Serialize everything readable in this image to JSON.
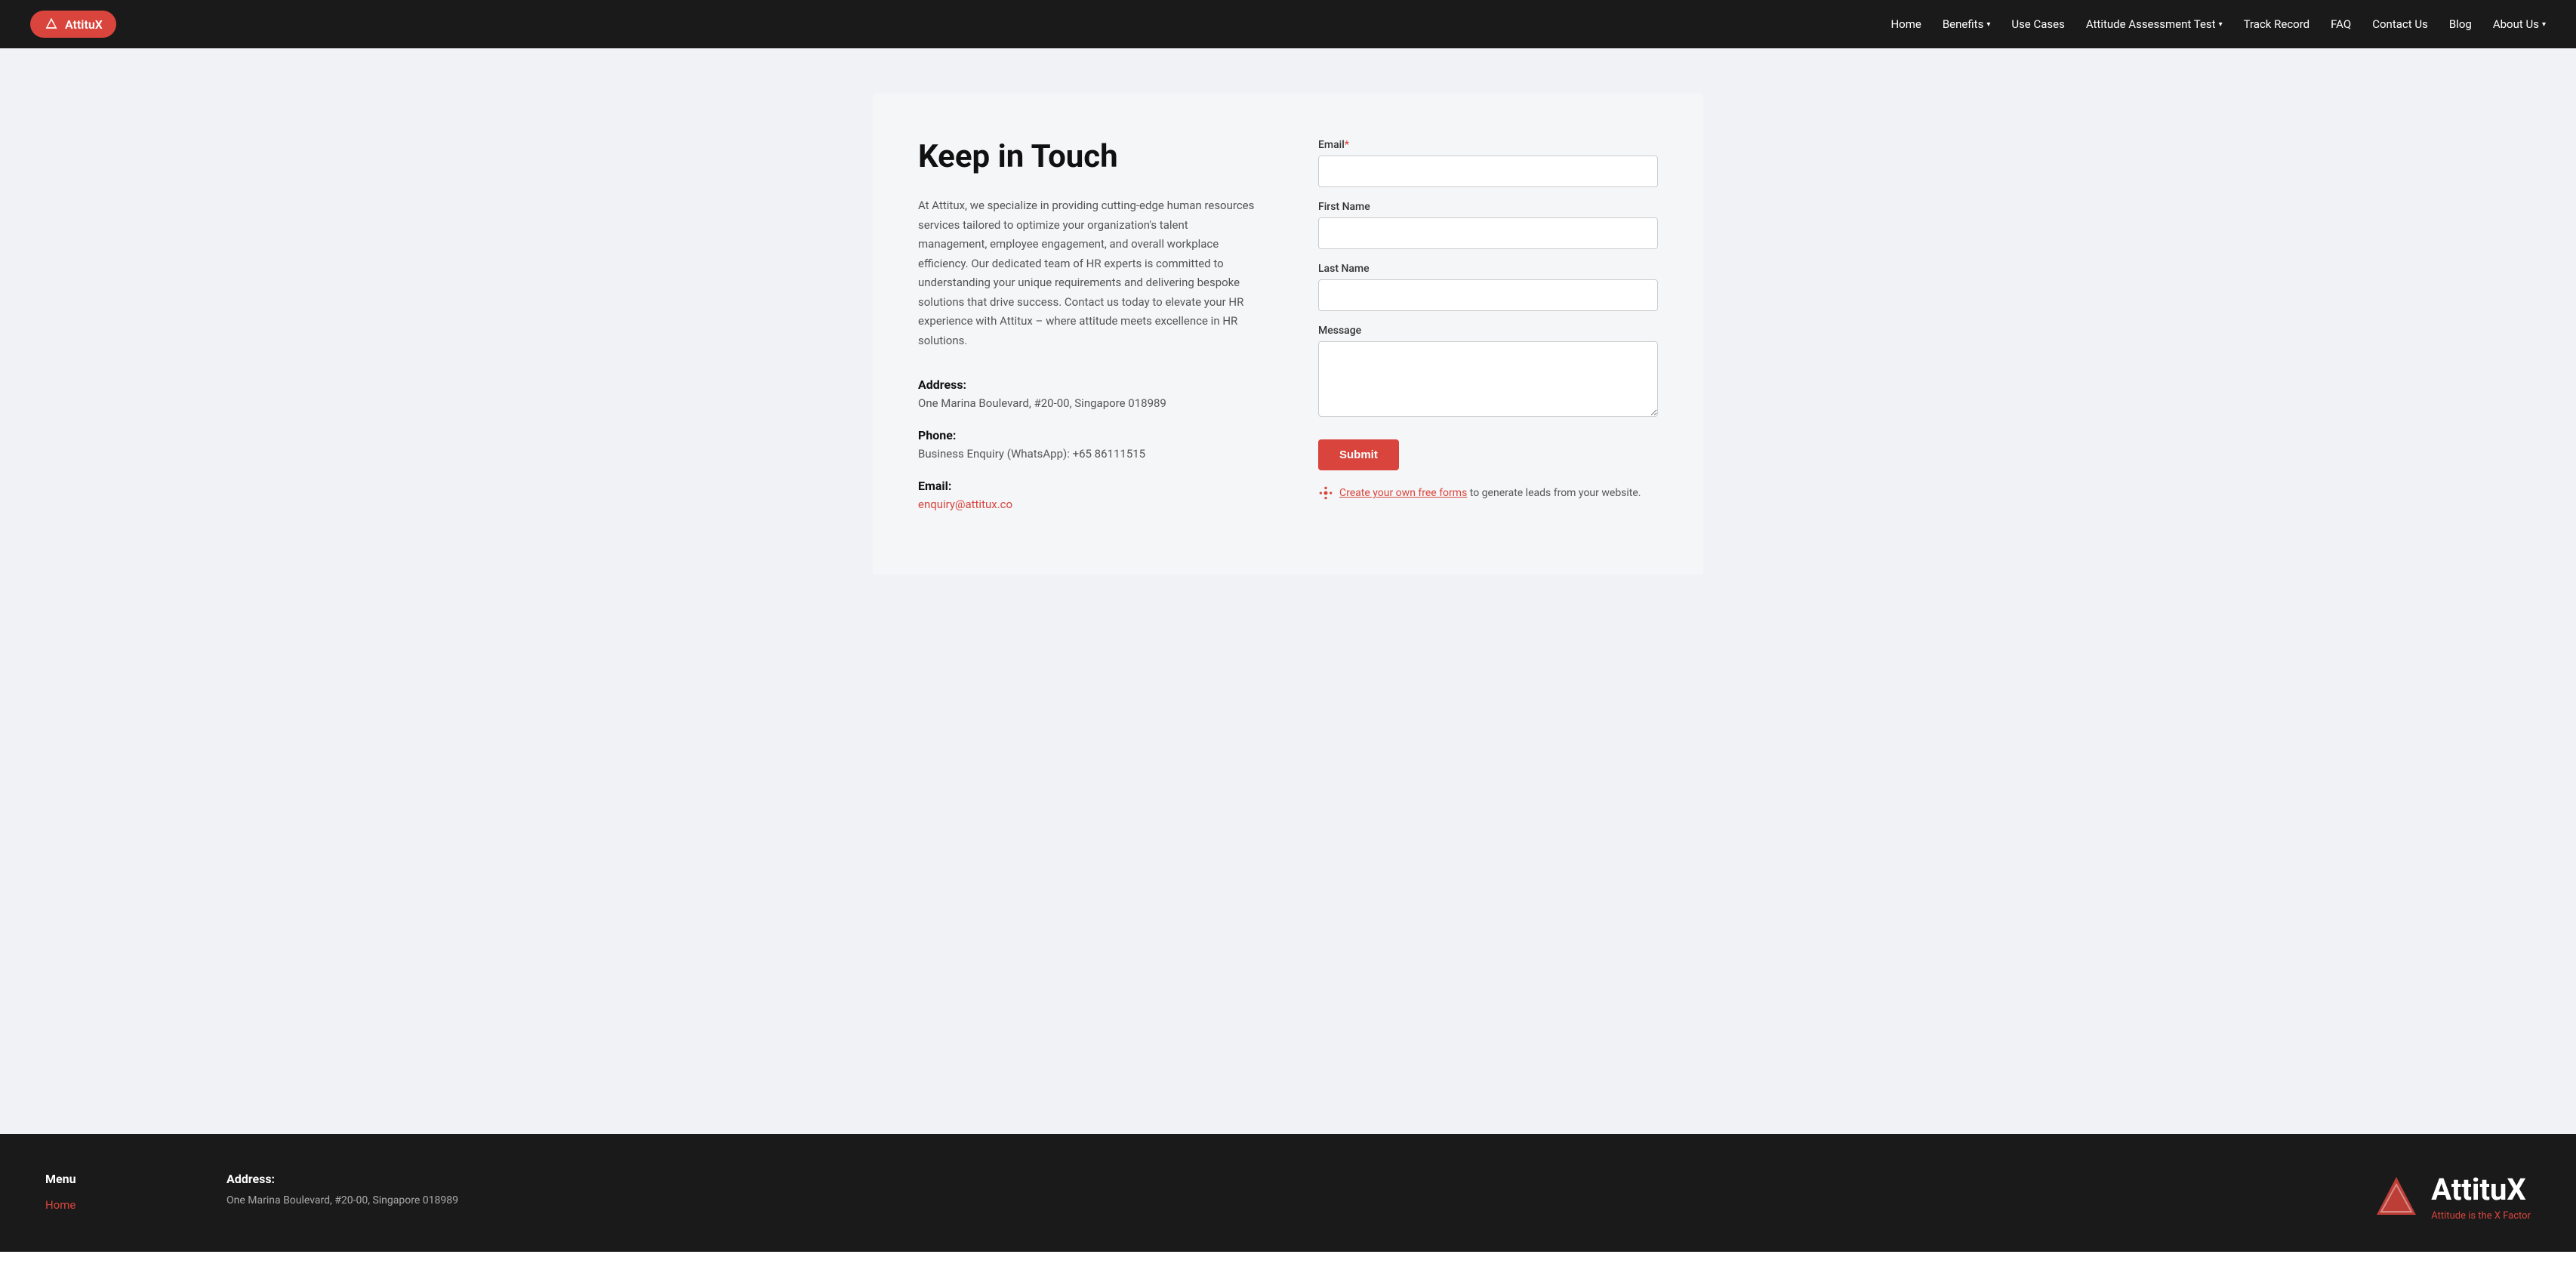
{
  "navbar": {
    "logo_text": "AttituX",
    "nav_items": [
      {
        "label": "Home",
        "has_dropdown": false
      },
      {
        "label": "Benefits",
        "has_dropdown": true
      },
      {
        "label": "Use Cases",
        "has_dropdown": false
      },
      {
        "label": "Attitude Assessment Test",
        "has_dropdown": true
      },
      {
        "label": "Track Record",
        "has_dropdown": false
      },
      {
        "label": "FAQ",
        "has_dropdown": false
      },
      {
        "label": "Contact Us",
        "has_dropdown": false
      },
      {
        "label": "Blog",
        "has_dropdown": false
      },
      {
        "label": "About Us",
        "has_dropdown": true
      }
    ]
  },
  "contact": {
    "title": "Keep in Touch",
    "description": "At Attitux, we specialize in providing cutting-edge human resources services tailored to optimize your organization's talent management, employee engagement, and overall workplace efficiency. Our dedicated team of HR experts is committed to understanding your unique requirements and delivering bespoke solutions that drive success. Contact us today to elevate your HR experience with Attitux – where attitude meets excellence in HR solutions.",
    "address_label": "Address:",
    "address_value": "One Marina Boulevard, #20-00, Singapore 018989",
    "phone_label": "Phone:",
    "phone_value": "Business Enquiry (WhatsApp): +65 86111515",
    "email_label": "Email:",
    "email_value": "enquiry@attitux.co"
  },
  "form": {
    "email_label": "Email",
    "email_required": "*",
    "first_name_label": "First Name",
    "last_name_label": "Last Name",
    "message_label": "Message",
    "submit_label": "Submit",
    "hubspot_text": "to generate leads from your website.",
    "hubspot_link_label": "Create your own free forms"
  },
  "footer": {
    "menu_heading": "Menu",
    "menu_items": [
      {
        "label": "Home"
      }
    ],
    "address_heading": "Address:",
    "address_value": "One Marina Boulevard, #20-00, Singapore 018989",
    "logo_text": "AttituX",
    "tagline": "Attitude is the X Factor"
  }
}
